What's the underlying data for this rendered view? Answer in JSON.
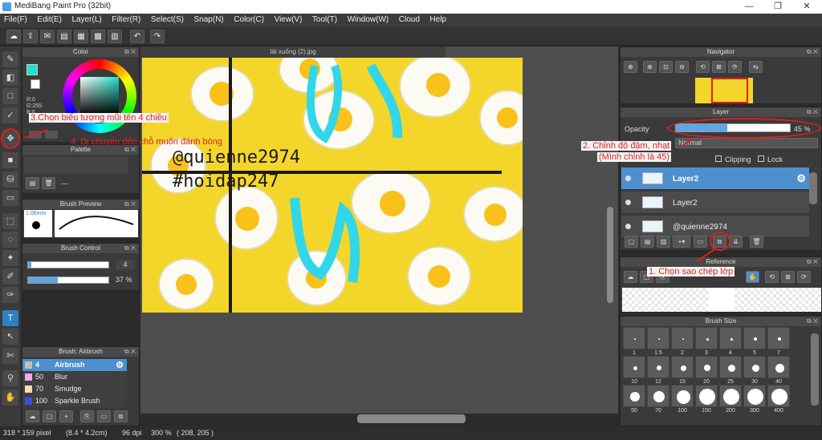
{
  "window": {
    "title": "MediBang Paint Pro (32bit)",
    "minimize": "—",
    "restore": "❐",
    "close": "✕"
  },
  "menu": [
    "File(F)",
    "Edit(E)",
    "Layer(L)",
    "Filter(R)",
    "Select(S)",
    "Snap(N)",
    "Color(C)",
    "View(V)",
    "Tool(T)",
    "Window(W)",
    "Cloud",
    "Help"
  ],
  "panels": {
    "color": "Color",
    "palette": "Palette",
    "palette_value": "---",
    "brush_preview": "Brush Preview",
    "brush_preview_size": "1.06mm",
    "brush_control": "Brush Control",
    "brush_size_value": "4",
    "brush_opacity_value": "37 %",
    "brush_list": "Brush: Airbrush",
    "navigator": "Navigator",
    "layer": "Layer",
    "reference": "Reference",
    "brush_size": "Brush Size"
  },
  "color_values": {
    "r": "R:0",
    "g": "G:255",
    "b": "B:0"
  },
  "document": {
    "tab": "tải xuống (2).jpg",
    "watermark1": "@quienne2974",
    "watermark2": "#hoidap247"
  },
  "layer_panel": {
    "opacity_label": "Opacity",
    "opacity_value": "45 %",
    "opacity": 0.45,
    "blend_mode": "Normal",
    "clipping": "Clipping",
    "lock": "Lock",
    "layers": [
      {
        "name": "Layer2",
        "selected": true
      },
      {
        "name": "Layer2",
        "selected": false
      },
      {
        "name": "@quienne2974",
        "selected": false
      }
    ]
  },
  "brushes": [
    {
      "size": "4",
      "name": "Airbrush",
      "color": "#bfbfbf",
      "selected": true
    },
    {
      "size": "50",
      "name": "Blur",
      "color": "#f2a6f2",
      "selected": false
    },
    {
      "size": "70",
      "name": "Smudge",
      "color": "#f5dcb5",
      "selected": false
    },
    {
      "size": "100",
      "name": "Sparkle Brush",
      "color": "#3355dd",
      "selected": false
    }
  ],
  "brush_sizes": [
    "1",
    "1.5",
    "2",
    "3",
    "4",
    "5",
    "7",
    "10",
    "12",
    "15",
    "20",
    "25",
    "30",
    "40",
    "50",
    "70",
    "100",
    "150",
    "200",
    "300",
    "400"
  ],
  "annotations": {
    "step1": "1. Chọn sao chép lớp",
    "step2_line1": "2. Chỉnh độ đậm, nhạt",
    "step2_line2": "(Mình chỉnh là 45)",
    "step3": "3.Chọn biểu tượng mũi tên 4 chiều",
    "step4": "4. Di chuyển đến chỗ muốn đánh bóng"
  },
  "status": {
    "size": "318 * 159 pixel",
    "dims": "(8.4 * 4.2cm)",
    "dpi": "96 dpi",
    "zoom": "300 %",
    "coords": "( 208, 205 )"
  },
  "colors": {
    "accent": "#4e90cf",
    "annotation": "#e02020",
    "canvas_bg": "#f4d62a"
  }
}
